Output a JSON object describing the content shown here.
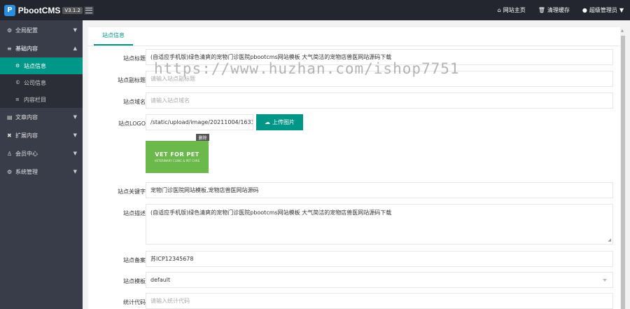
{
  "app": {
    "logo_mark": "P",
    "name": "PbootCMS",
    "version": "V3.1.2"
  },
  "header": {
    "links": [
      {
        "icon": "home-icon",
        "glyph": "⌂",
        "label": "网站主页"
      },
      {
        "icon": "trash-icon",
        "glyph": "🗑",
        "label": "清理缓存"
      },
      {
        "icon": "user-icon",
        "glyph": "●",
        "label": "超级管理员"
      }
    ]
  },
  "sidebar": {
    "items": [
      {
        "icon": "gear-icon",
        "glyph": "⚙",
        "label": "全局配置",
        "caret": "▼"
      },
      {
        "icon": "sliders-icon",
        "glyph": "≡",
        "label": "基础内容",
        "caret": "▲"
      },
      {
        "icon": "file-icon",
        "glyph": "▤",
        "label": "文章内容",
        "caret": "▼"
      },
      {
        "icon": "puzzle-icon",
        "glyph": "✖",
        "label": "扩展内容",
        "caret": "▼"
      },
      {
        "icon": "member-icon",
        "glyph": "♙",
        "label": "会员中心",
        "caret": "▼"
      },
      {
        "icon": "system-icon",
        "glyph": "⚙",
        "label": "系统管理",
        "caret": "▼"
      }
    ],
    "sub_items": [
      {
        "icon": "gear-icon",
        "glyph": "⚙",
        "label": "站点信息"
      },
      {
        "icon": "copyright-icon",
        "glyph": "©",
        "label": "公司信息"
      },
      {
        "icon": "list-icon",
        "glyph": "≡",
        "label": "内容栏目"
      }
    ]
  },
  "tab": {
    "label": "站点信息"
  },
  "form": {
    "title": {
      "label": "站点标题",
      "value": "(自适应手机版)绿色清爽的宠物门诊医院pbootcms网站模板 大气简洁的宠物店兽医网站源码下载"
    },
    "subtitle": {
      "label": "站点副标题",
      "placeholder": "请输入站点副标题"
    },
    "domain": {
      "label": "站点域名",
      "placeholder": "请输入站点域名"
    },
    "logo": {
      "label": "站点LOGO",
      "value": "/static/upload/image/20211004/1633307",
      "upload_label": "上传图片",
      "upload_icon": "☁",
      "delete_label": "删除",
      "preview_title": "VET FOR PET",
      "preview_sub": "VETERINARY CLINIC & PET CARE"
    },
    "keywords": {
      "label": "站点关键字",
      "value": "宠物门诊医院网站模板,宠物店兽医网站源码"
    },
    "description": {
      "label": "站点描述",
      "value": "(自适应手机版)绿色清爽的宠物门诊医院pbootcms网站模板 大气简洁的宠物店兽医网站源码下载"
    },
    "icp": {
      "label": "站点备案",
      "value": "苏ICP12345678"
    },
    "template": {
      "label": "站点模板",
      "value": "default"
    },
    "stats": {
      "label": "统计代码",
      "placeholder": "请输入统计代码"
    }
  },
  "watermark": "https://www.huzhan.com/ishop7751",
  "colors": {
    "accent": "#009688",
    "header_bg": "#23262e",
    "sidebar_bg": "#393d49"
  }
}
